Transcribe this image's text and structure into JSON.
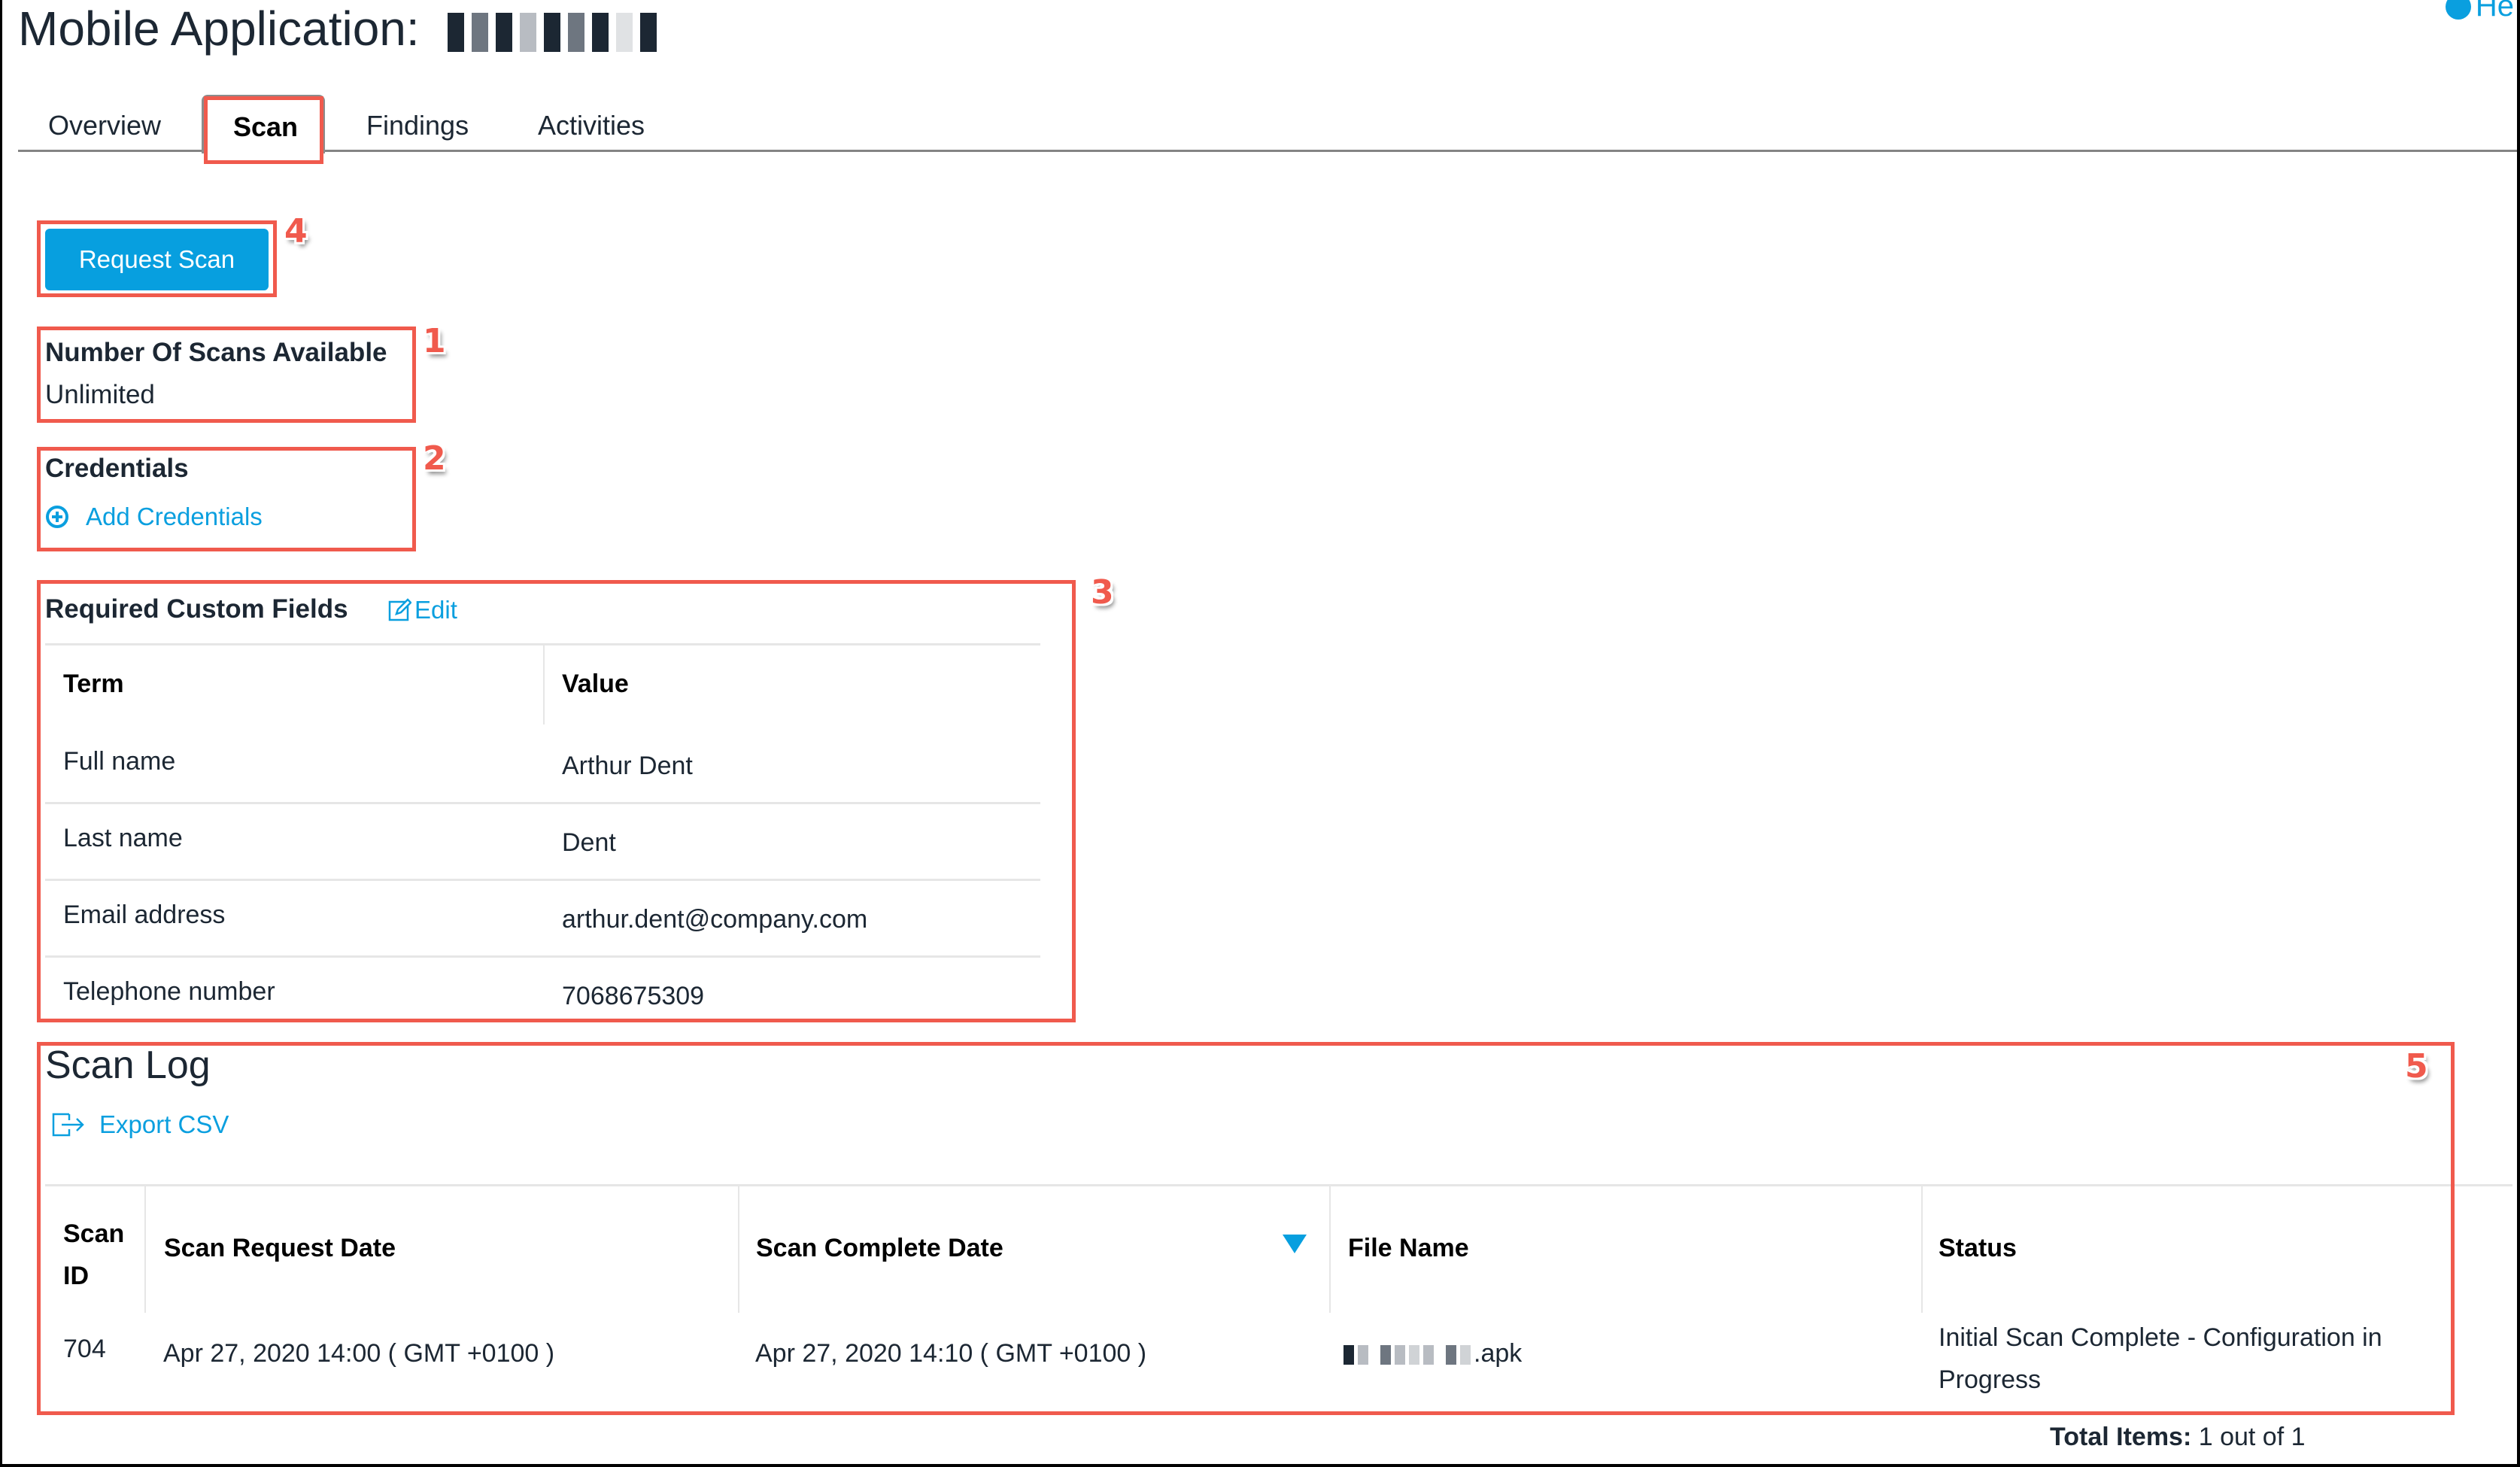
{
  "header": {
    "title": "Mobile Application:",
    "title_app_name_redacted": true,
    "help_label": "He"
  },
  "tabs": [
    {
      "label": "Overview",
      "active": false
    },
    {
      "label": "Scan",
      "active": true
    },
    {
      "label": "Findings",
      "active": false
    },
    {
      "label": "Activities",
      "active": false
    }
  ],
  "actions": {
    "request_scan_label": "Request Scan"
  },
  "scans_available": {
    "label": "Number Of Scans Available",
    "value": "Unlimited"
  },
  "credentials": {
    "label": "Credentials",
    "add_label": "Add Credentials"
  },
  "custom_fields": {
    "label": "Required Custom Fields",
    "edit_label": "Edit",
    "columns": [
      "Term",
      "Value"
    ],
    "rows": [
      {
        "term": "Full name",
        "value": "Arthur Dent"
      },
      {
        "term": "Last name",
        "value": "Dent"
      },
      {
        "term": "Email address",
        "value": "arthur.dent@company.com"
      },
      {
        "term": "Telephone number",
        "value": "7068675309"
      }
    ]
  },
  "scan_log": {
    "title": "Scan Log",
    "export_label": "Export CSV",
    "columns": {
      "scan_id_line1": "Scan",
      "scan_id_line2": "ID",
      "request_date": "Scan Request Date",
      "complete_date": "Scan Complete Date",
      "file_name": "File Name",
      "status": "Status"
    },
    "sort": {
      "column": "Scan Complete Date",
      "direction": "descending"
    },
    "rows": [
      {
        "scan_id": "704",
        "request_date": "Apr 27, 2020 14:00 ( GMT +0100 )",
        "complete_date": "Apr 27, 2020 14:10 ( GMT +0100 )",
        "file_name_suffix": ".apk",
        "status_line1": "Initial Scan Complete - Configuration in",
        "status_line2": "Progress"
      }
    ],
    "total_label": "Total Items:",
    "total_value": "1 out of 1"
  },
  "annotations": [
    "1",
    "2",
    "3",
    "4",
    "5"
  ],
  "colors": {
    "accent": "#079fdf",
    "annotation": "#f05a4d",
    "text": "#1c2733"
  }
}
